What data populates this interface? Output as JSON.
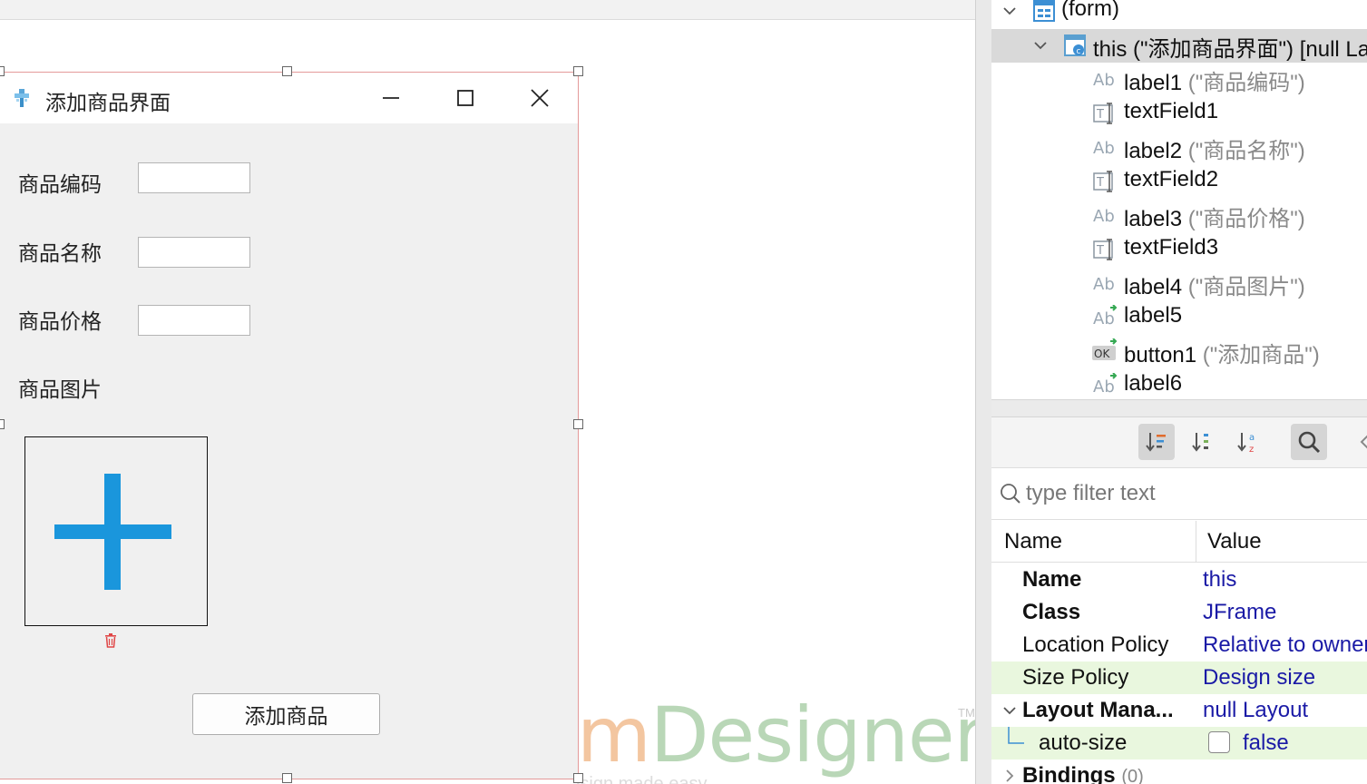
{
  "design_frame": {
    "title": "添加商品界面",
    "fields": [
      {
        "label": "商品编码",
        "value": ""
      },
      {
        "label": "商品名称",
        "value": ""
      },
      {
        "label": "商品价格",
        "value": ""
      }
    ],
    "image_label": "商品图片",
    "add_button": "添加商品"
  },
  "watermark": {
    "m": "m",
    "designer": "Designer",
    "tm": "TM",
    "subtitle": "Swing GUI design made easy"
  },
  "component_tree": {
    "root": "(form)",
    "this": "this (\"添加商品界面\") [null Layout]",
    "items": [
      {
        "name": "label1",
        "detail": "(\"商品编码\")",
        "icon": "label-icon"
      },
      {
        "name": "textField1",
        "detail": "",
        "icon": "textfield-icon"
      },
      {
        "name": "label2",
        "detail": "(\"商品名称\")",
        "icon": "label-icon"
      },
      {
        "name": "textField2",
        "detail": "",
        "icon": "textfield-icon"
      },
      {
        "name": "label3",
        "detail": "(\"商品价格\")",
        "icon": "label-icon"
      },
      {
        "name": "textField3",
        "detail": "",
        "icon": "textfield-icon"
      },
      {
        "name": "label4",
        "detail": "(\"商品图片\")",
        "icon": "label-icon"
      },
      {
        "name": "label5",
        "detail": "",
        "icon": "label-action-icon"
      },
      {
        "name": "button1",
        "detail": "(\"添加商品\")",
        "icon": "button-icon"
      },
      {
        "name": "label6",
        "detail": "",
        "icon": "label-action-icon"
      }
    ]
  },
  "properties": {
    "filter_placeholder": "type filter text",
    "col_name": "Name",
    "col_value": "Value",
    "rows": [
      {
        "name": "Name",
        "value": "this"
      },
      {
        "name": "Class",
        "value": "JFrame"
      },
      {
        "name": "Location Policy",
        "value": "Relative to owner"
      },
      {
        "name": "Size Policy",
        "value": "Design size"
      },
      {
        "name": "Layout Mana...",
        "value": "null Layout"
      },
      {
        "name": "auto-size",
        "value": "false"
      }
    ],
    "bindings_label": "Bindings",
    "bindings_count": "(0)"
  },
  "colors": {
    "accent": "#1a96dc",
    "selection": "#d9d9d9",
    "highlight": "#e9f7de",
    "value_text": "#1a1aa6"
  }
}
